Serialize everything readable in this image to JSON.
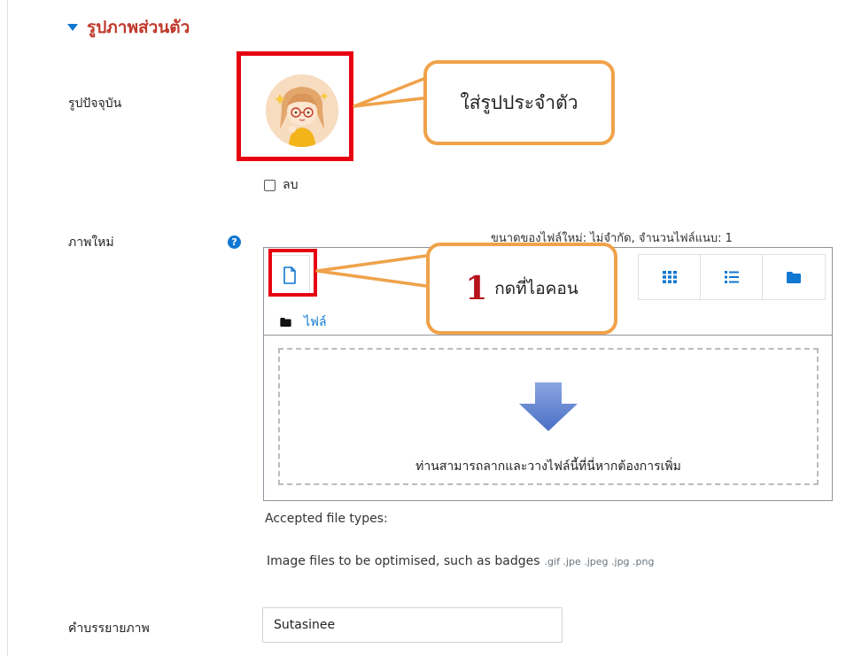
{
  "section": {
    "title": "รูปภาพส่วนตัว"
  },
  "current_picture": {
    "label": "รูปปัจจุบัน",
    "callout_text": "ใส่รูปประจำตัว",
    "delete_label": "ลบ",
    "delete_checked": false
  },
  "new_picture": {
    "label": "ภาพใหม่",
    "limits_text": "ขนาดของไฟล์ใหม่: ไม่จำกัด, จำนวนไฟล์แนบ: 1",
    "step_number": "1",
    "step_text": "กดที่ไอคอน",
    "path_label": "ไฟล์",
    "dropzone_text": "ท่านสามารถลากและวางไฟล์นี้ที่นี่หากต้องการเพิ่ม",
    "accepted_label": "Accepted file types:",
    "accepted_desc": "Image files to be optimised, such as badges",
    "accepted_exts": ".gif .jpe .jpeg .jpg .png"
  },
  "description": {
    "label": "คำบรรยายภาพ",
    "value": "Sutasinee"
  },
  "colors": {
    "section_title": "#c0392b",
    "link": "#1177d1",
    "annotation_frame": "#e60012",
    "callout_border": "#f0a24a",
    "step_number": "#b5121b"
  },
  "icons": {
    "section_toggle": "caret-down-icon",
    "add_file": "file-add-icon",
    "help": "question-circle-icon",
    "view_icons": "grid-icon",
    "view_list": "list-icon",
    "view_tree": "folder-icon",
    "path_folder": "folder-icon",
    "dropzone": "arrow-down-icon"
  }
}
